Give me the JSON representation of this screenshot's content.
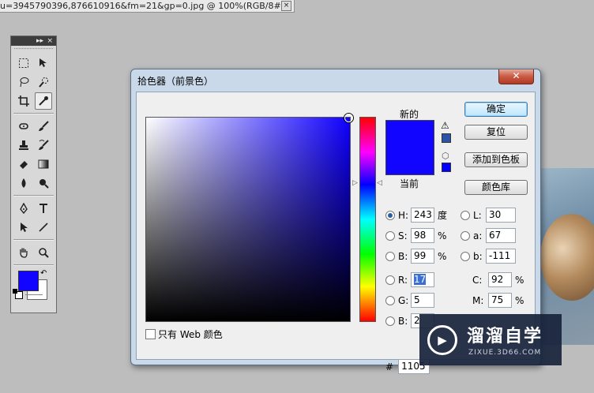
{
  "document_tab": {
    "title": "u=3945790396,876610916&fm=21&gp=0.jpg @ 100%(RGB/8#)",
    "close_glyph": "×"
  },
  "tools_panel": {
    "collapse_glyph": "▸▸",
    "close_glyph": "×",
    "tools": [
      "marquee-icon",
      "move-icon",
      "lasso-icon",
      "quick-select-icon",
      "crop-icon",
      "eyedropper-icon",
      "spot-heal-icon",
      "brush-icon",
      "clone-stamp-icon",
      "history-brush-icon",
      "eraser-icon",
      "gradient-icon",
      "blur-icon",
      "dodge-icon",
      "pen-icon",
      "type-icon",
      "path-select-icon",
      "line-icon",
      "hand-icon",
      "zoom-icon"
    ],
    "active_tool": "eyedropper-icon",
    "foreground_color": "#1105ff",
    "background_color": "#ffffff"
  },
  "dialog": {
    "title": "拾色器（前景色）",
    "close_glyph": "✕",
    "label_new": "新的",
    "label_current": "当前",
    "new_color": "#1105ff",
    "current_color": "#1105ff",
    "gamut_swatch_color": "#2b53a6",
    "web_swatch_color": "#0000ff",
    "web_only_label": "只有 Web 颜色",
    "buttons": {
      "ok": "确定",
      "reset": "复位",
      "add_to_swatches": "添加到色板",
      "color_libraries": "颜色库"
    },
    "hsb": [
      {
        "name": "H:",
        "value": "243",
        "unit": "度",
        "selected": true
      },
      {
        "name": "S:",
        "value": "98",
        "unit": "%",
        "selected": false
      },
      {
        "name": "B:",
        "value": "99",
        "unit": "%",
        "selected": false
      }
    ],
    "rgb": [
      {
        "name": "R:",
        "value": "17"
      },
      {
        "name": "G:",
        "value": "5"
      },
      {
        "name": "B:",
        "value": "2"
      }
    ],
    "lab": [
      {
        "name": "L:",
        "value": "30"
      },
      {
        "name": "a:",
        "value": "67"
      },
      {
        "name": "b:",
        "value": "-111"
      }
    ],
    "cmyk": [
      {
        "name": "C:",
        "value": "92",
        "unit": "%"
      },
      {
        "name": "M:",
        "value": "75",
        "unit": "%"
      }
    ],
    "hex_label": "#",
    "hex_value": "1105"
  },
  "watermark": {
    "name": "溜溜自学",
    "url": "ZIXUE.3D66.COM"
  }
}
